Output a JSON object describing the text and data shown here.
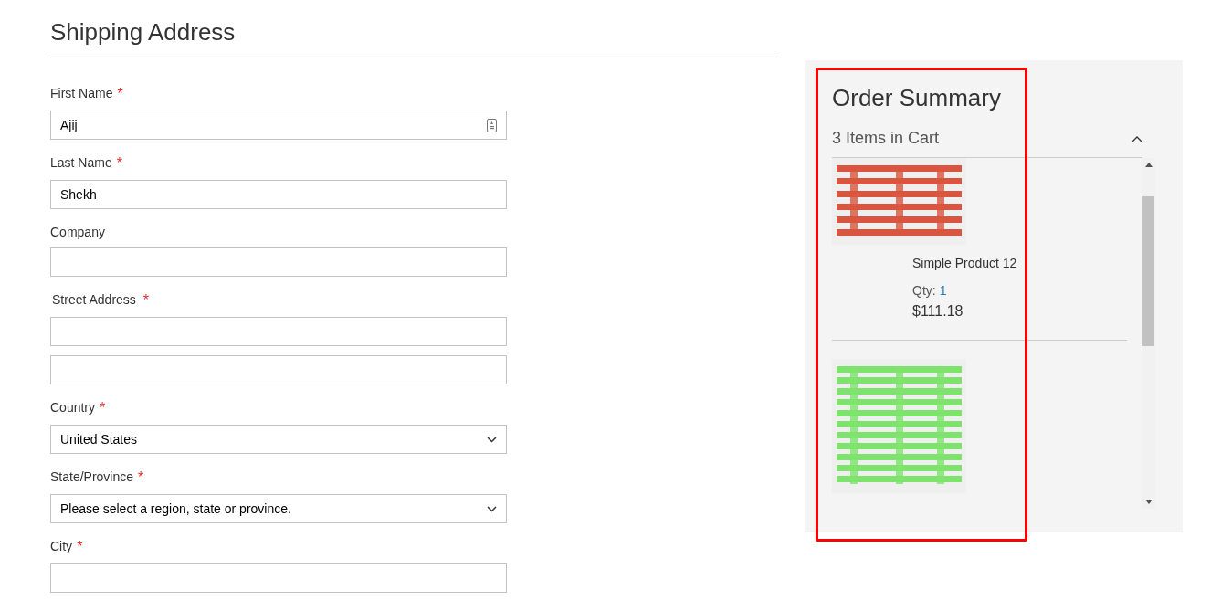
{
  "shipping": {
    "title": "Shipping Address",
    "required_mark": "*",
    "fields": [
      {
        "label": "First Name",
        "required": true,
        "kind": "text",
        "value": "Ajij",
        "autofill_icon": true
      },
      {
        "label": "Last Name",
        "required": true,
        "kind": "text",
        "value": "Shekh"
      },
      {
        "label": "Company",
        "required": false,
        "kind": "text"
      },
      {
        "label": "Street Address",
        "required": true,
        "kind": "street"
      },
      {
        "label": "Country",
        "required": true,
        "kind": "select",
        "value": "United States"
      },
      {
        "label": "State/Province",
        "required": true,
        "kind": "select",
        "value": "Please select a region, state or province."
      },
      {
        "label": "City",
        "required": true,
        "kind": "text"
      }
    ]
  },
  "summary": {
    "title": "Order Summary",
    "cart_label": "3 Items in Cart",
    "expanded": true,
    "items": [
      {
        "picture": {
          "kind": "picture"
        },
        "name": "Simple Product 12",
        "qty_label": "Qty:",
        "qty": "1",
        "price": "$111.18"
      },
      {
        "picture": {
          "kind": "picture"
        }
      }
    ]
  }
}
